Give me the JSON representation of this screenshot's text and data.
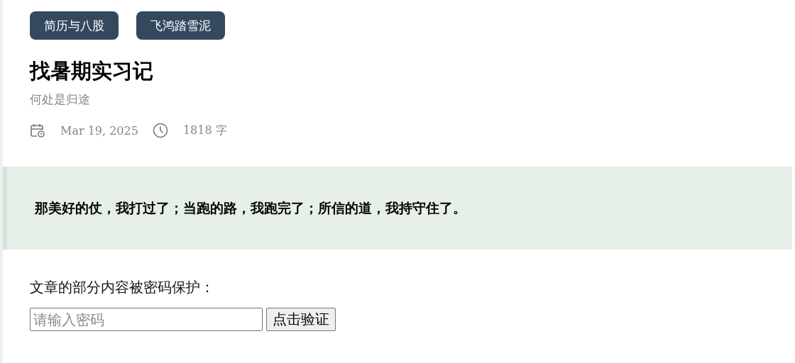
{
  "tags": [
    {
      "label": "简历与八股"
    },
    {
      "label": "飞鸿踏雪泥"
    }
  ],
  "title": "找暑期实习记",
  "subtitle": "何处是归途",
  "meta": {
    "date": "Mar 19, 2025",
    "word_count": "1818 字"
  },
  "quote": "那美好的仗，我打过了；当跑的路，我跑完了；所信的道，我持守住了。",
  "protected_notice": "文章的部分内容被密码保护：",
  "password": {
    "placeholder": "请输入密码",
    "button": "点击验证"
  }
}
